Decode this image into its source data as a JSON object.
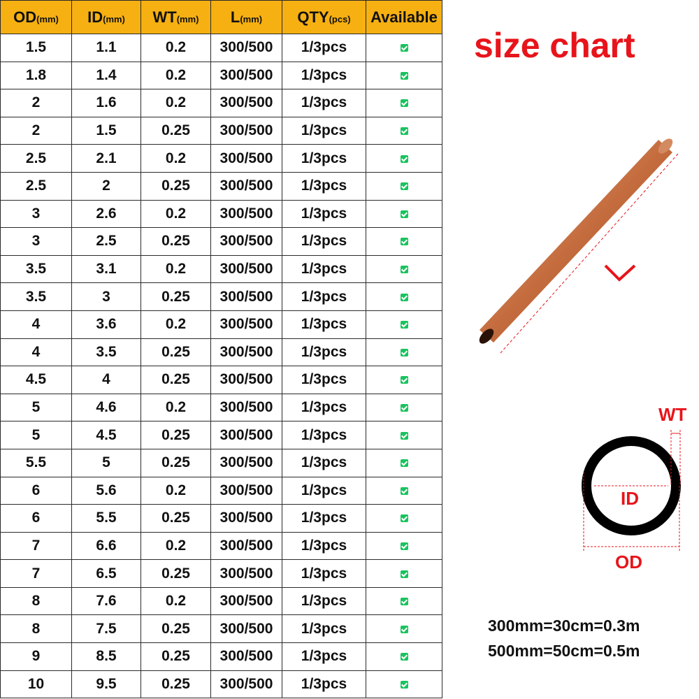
{
  "table": {
    "headers": [
      {
        "main": "OD",
        "unit": "(mm)"
      },
      {
        "main": "ID",
        "unit": "(mm)"
      },
      {
        "main": "WT",
        "unit": "(mm)"
      },
      {
        "main": "L",
        "unit": "(mm)"
      },
      {
        "main": "QTY",
        "unit": "(pcs)"
      },
      {
        "main": "Available",
        "unit": ""
      }
    ],
    "rows": [
      {
        "od": "1.5",
        "id": "1.1",
        "wt": "0.2",
        "l": "300/500",
        "qty": "1/3pcs",
        "available": true
      },
      {
        "od": "1.8",
        "id": "1.4",
        "wt": "0.2",
        "l": "300/500",
        "qty": "1/3pcs",
        "available": true
      },
      {
        "od": "2",
        "id": "1.6",
        "wt": "0.2",
        "l": "300/500",
        "qty": "1/3pcs",
        "available": true
      },
      {
        "od": "2",
        "id": "1.5",
        "wt": "0.25",
        "l": "300/500",
        "qty": "1/3pcs",
        "available": true
      },
      {
        "od": "2.5",
        "id": "2.1",
        "wt": "0.2",
        "l": "300/500",
        "qty": "1/3pcs",
        "available": true
      },
      {
        "od": "2.5",
        "id": "2",
        "wt": "0.25",
        "l": "300/500",
        "qty": "1/3pcs",
        "available": true
      },
      {
        "od": "3",
        "id": "2.6",
        "wt": "0.2",
        "l": "300/500",
        "qty": "1/3pcs",
        "available": true
      },
      {
        "od": "3",
        "id": "2.5",
        "wt": "0.25",
        "l": "300/500",
        "qty": "1/3pcs",
        "available": true
      },
      {
        "od": "3.5",
        "id": "3.1",
        "wt": "0.2",
        "l": "300/500",
        "qty": "1/3pcs",
        "available": true
      },
      {
        "od": "3.5",
        "id": "3",
        "wt": "0.25",
        "l": "300/500",
        "qty": "1/3pcs",
        "available": true
      },
      {
        "od": "4",
        "id": "3.6",
        "wt": "0.2",
        "l": "300/500",
        "qty": "1/3pcs",
        "available": true
      },
      {
        "od": "4",
        "id": "3.5",
        "wt": "0.25",
        "l": "300/500",
        "qty": "1/3pcs",
        "available": true
      },
      {
        "od": "4.5",
        "id": "4",
        "wt": "0.25",
        "l": "300/500",
        "qty": "1/3pcs",
        "available": true
      },
      {
        "od": "5",
        "id": "4.6",
        "wt": "0.2",
        "l": "300/500",
        "qty": "1/3pcs",
        "available": true
      },
      {
        "od": "5",
        "id": "4.5",
        "wt": "0.25",
        "l": "300/500",
        "qty": "1/3pcs",
        "available": true
      },
      {
        "od": "5.5",
        "id": "5",
        "wt": "0.25",
        "l": "300/500",
        "qty": "1/3pcs",
        "available": true
      },
      {
        "od": "6",
        "id": "5.6",
        "wt": "0.2",
        "l": "300/500",
        "qty": "1/3pcs",
        "available": true
      },
      {
        "od": "6",
        "id": "5.5",
        "wt": "0.25",
        "l": "300/500",
        "qty": "1/3pcs",
        "available": true
      },
      {
        "od": "7",
        "id": "6.6",
        "wt": "0.2",
        "l": "300/500",
        "qty": "1/3pcs",
        "available": true
      },
      {
        "od": "7",
        "id": "6.5",
        "wt": "0.25",
        "l": "300/500",
        "qty": "1/3pcs",
        "available": true
      },
      {
        "od": "8",
        "id": "7.6",
        "wt": "0.2",
        "l": "300/500",
        "qty": "1/3pcs",
        "available": true
      },
      {
        "od": "8",
        "id": "7.5",
        "wt": "0.25",
        "l": "300/500",
        "qty": "1/3pcs",
        "available": true
      },
      {
        "od": "9",
        "id": "8.5",
        "wt": "0.25",
        "l": "300/500",
        "qty": "1/3pcs",
        "available": true
      },
      {
        "od": "10",
        "id": "9.5",
        "wt": "0.25",
        "l": "300/500",
        "qty": "1/3pcs",
        "available": true
      }
    ]
  },
  "title": "size chart",
  "diagram": {
    "wt_label": "WT",
    "id_label": "ID",
    "od_label": "OD"
  },
  "conversions": [
    "300mm=30cm=0.3m",
    "500mm=50cm=0.5m"
  ],
  "colors": {
    "header_bg": "#f6b011",
    "accent_red": "#e8141b",
    "check_green": "#19c35e",
    "copper": "#c8784a"
  },
  "icons": {
    "available": "check-square-icon",
    "length_marker": "chevron-down-icon"
  }
}
